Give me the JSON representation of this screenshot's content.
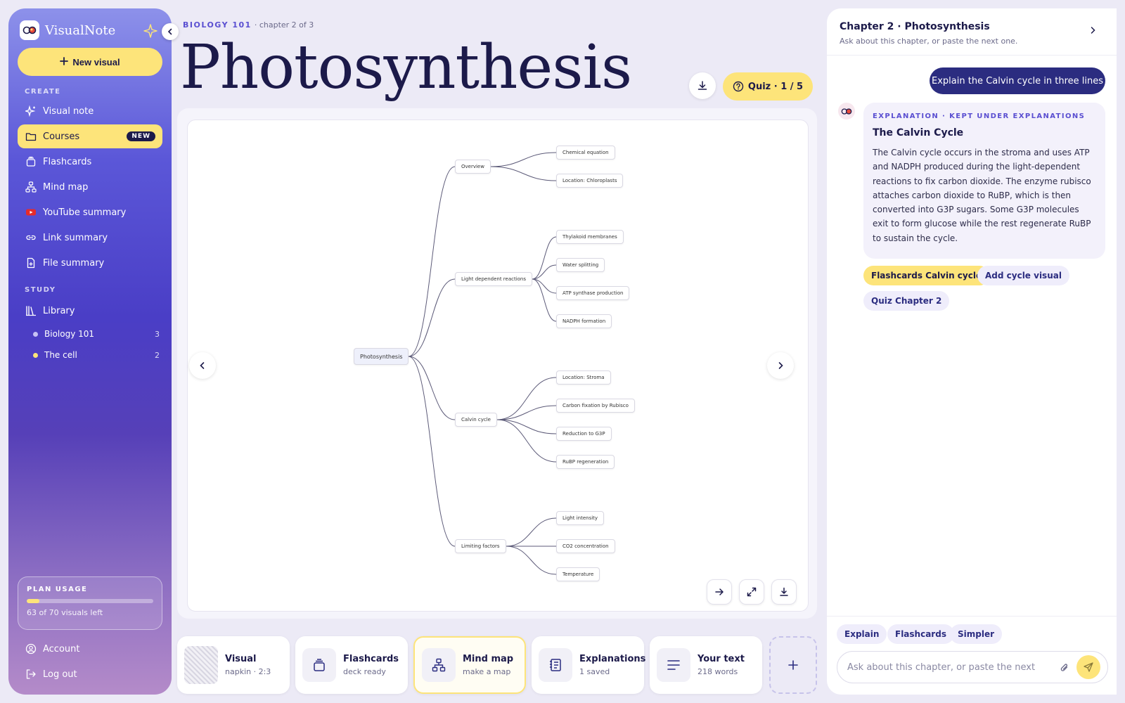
{
  "app": {
    "name": "VisualNote"
  },
  "sidebar": {
    "new_visual": "New visual",
    "create_label": "CREATE",
    "create_items": [
      {
        "label": "Visual note"
      },
      {
        "label": "Courses",
        "badge": "NEW",
        "active": true
      },
      {
        "label": "Flashcards"
      },
      {
        "label": "Mind map"
      },
      {
        "label": "YouTube summary"
      },
      {
        "label": "Link summary"
      },
      {
        "label": "File summary"
      }
    ],
    "study_label": "STUDY",
    "library": "Library",
    "library_items": [
      {
        "label": "Biology 101",
        "count": "3",
        "color": "#c8c2f4"
      },
      {
        "label": "The cell",
        "count": "2",
        "color": "#fde47a"
      }
    ],
    "plan": {
      "title": "PLAN USAGE",
      "text": "63 of 70 visuals left",
      "used_fraction": 0.1
    },
    "account": "Account",
    "logout": "Log out"
  },
  "header": {
    "course": "BIOLOGY 101",
    "chapter": "· chapter 2 of 3",
    "title": "Photosynthesis",
    "quiz": "Quiz · 1 / 5"
  },
  "mindmap": {
    "root": "Photosynthesis",
    "branches": [
      {
        "label": "Overview",
        "children": [
          "Chemical equation",
          "Location: Chloroplasts"
        ]
      },
      {
        "label": "Light dependent reactions",
        "children": [
          "Thylakoid membranes",
          "Water splitting",
          "ATP synthase production",
          "NADPH formation"
        ]
      },
      {
        "label": "Calvin cycle",
        "children": [
          "Location: Stroma",
          "Carbon fixation by Rubisco",
          "Reduction to G3P",
          "RuBP regeneration"
        ]
      },
      {
        "label": "Limiting factors",
        "children": [
          "Light intensity",
          "CO2 concentration",
          "Temperature"
        ]
      }
    ]
  },
  "outputs": [
    {
      "title": "Visual",
      "sub": "napkin · 2:3"
    },
    {
      "title": "Flashcards",
      "sub": "deck ready"
    },
    {
      "title": "Mind map",
      "sub": "make a map"
    },
    {
      "title": "Explanations",
      "sub": "1 saved"
    },
    {
      "title": "Your text",
      "sub": "218 words"
    }
  ],
  "panel": {
    "title": "Chapter 2 · Photosynthesis",
    "subtitle": "Ask about this chapter, or paste the next one.",
    "user_message": "Explain the Calvin cycle in three lines",
    "reply_label": "EXPLANATION · KEPT UNDER EXPLANATIONS",
    "reply_title": "The Calvin Cycle",
    "reply_text": "The Calvin cycle occurs in the stroma and uses ATP and NADPH produced during the light-dependent reactions to fix carbon dioxide. The enzyme rubisco attaches carbon dioxide to RuBP, which is then converted into G3P sugars. Some G3P molecules exit to form glucose while the rest regenerate RuBP to sustain the cycle.",
    "suggestions": [
      "Flashcards Calvin cycle",
      "Add cycle visual",
      "Quiz Chapter 2"
    ],
    "quick": [
      "Explain",
      "Flashcards",
      "Simpler"
    ],
    "input_placeholder": "Ask about this chapter, or paste the next"
  },
  "colors": {
    "accent": "#fde47a",
    "primary": "#2b2c80",
    "brand": "#5a4fd1"
  }
}
